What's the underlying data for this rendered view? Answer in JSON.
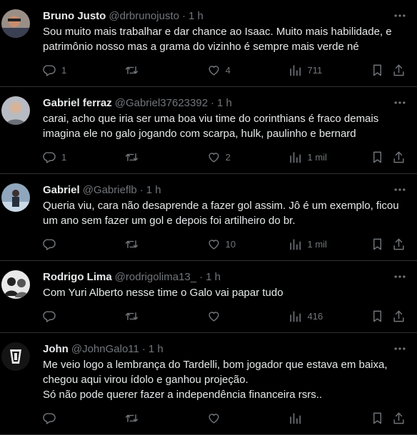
{
  "colors": {
    "background": "#000000",
    "text": "#e7e9ea",
    "muted": "#71767b",
    "border": "#2f3336"
  },
  "icons": {
    "reply": "reply-icon",
    "retweet": "retweet-icon",
    "like": "heart-icon",
    "views": "views-icon",
    "bookmark": "bookmark-icon",
    "share": "share-icon",
    "more": "more-icon"
  },
  "tweets": [
    {
      "name": "Bruno Justo",
      "handle": "@drbrunojusto",
      "time": "1 h",
      "text": "Sou muito mais trabalhar e dar chance ao Isaac. Muito mais habilidade, e\npatrimônio nosso mas a grama do vizinho é sempre mais verde né",
      "replies": "1",
      "retweets": "",
      "likes": "4",
      "views": "711"
    },
    {
      "name": "Gabriel ferraz",
      "handle": "@Gabriel37623392",
      "time": "1 h",
      "text": "carai, acho que iria ser uma boa viu time do corinthians é fraco demais\nimagina ele no galo jogando com scarpa, hulk, paulinho e bernard",
      "replies": "1",
      "retweets": "",
      "likes": "2",
      "views": "1 mil"
    },
    {
      "name": "Gabriel",
      "handle": "@Gabrieflb",
      "time": "1 h",
      "text": "Queria viu, cara não desaprende a fazer gol assim. Jô é um exemplo, ficou\num ano sem fazer um gol e depois foi artilheiro do br.",
      "replies": "",
      "retweets": "",
      "likes": "10",
      "views": "1 mil"
    },
    {
      "name": "Rodrigo Lima",
      "handle": "@rodrigolima13_",
      "time": "1 h",
      "text": "Com Yuri Alberto nesse time o Galo vai papar tudo",
      "replies": "",
      "retweets": "",
      "likes": "",
      "views": "416"
    },
    {
      "name": "John",
      "handle": "@JohnGalo11",
      "time": "1 h",
      "text": "Me veio logo a lembrança do Tardelli, bom jogador que estava em baixa,\nchegou aqui virou ídolo e ganhou projeção.\nSó não pode querer fazer a independência financeira rsrs..",
      "replies": "",
      "retweets": "",
      "likes": "",
      "views": ""
    }
  ]
}
